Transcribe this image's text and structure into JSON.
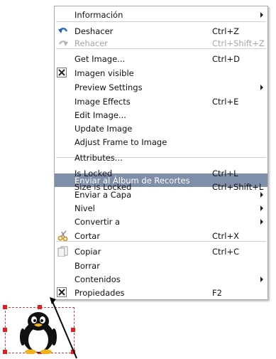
{
  "menu": {
    "items": [
      {
        "label": "Información",
        "shortcut": "",
        "submenu": true,
        "state": "normal"
      },
      {
        "label": "Deshacer",
        "shortcut": "Ctrl+Z",
        "submenu": false,
        "state": "normal",
        "icon": "undo-icon"
      },
      {
        "label": "Rehacer",
        "shortcut": "Ctrl+Shift+Z",
        "submenu": false,
        "state": "disabled",
        "icon": "redo-icon"
      },
      {
        "label": "Get Image...",
        "shortcut": "Ctrl+D",
        "submenu": false,
        "state": "normal"
      },
      {
        "label": "Imagen visible",
        "shortcut": "",
        "submenu": false,
        "state": "checked"
      },
      {
        "label": "Preview Settings",
        "shortcut": "",
        "submenu": true,
        "state": "normal"
      },
      {
        "label": "Image Effects",
        "shortcut": "Ctrl+E",
        "submenu": false,
        "state": "normal"
      },
      {
        "label": "Edit Image...",
        "shortcut": "",
        "submenu": false,
        "state": "normal"
      },
      {
        "label": "Update Image",
        "shortcut": "",
        "submenu": false,
        "state": "normal"
      },
      {
        "label": "Adjust Frame to Image",
        "shortcut": "",
        "submenu": false,
        "state": "normal"
      },
      {
        "label": "Attributes...",
        "shortcut": "",
        "submenu": false,
        "state": "normal"
      },
      {
        "label": "Is Locked",
        "shortcut": "Ctrl+L",
        "submenu": false,
        "state": "normal"
      },
      {
        "label": "Size is Locked",
        "shortcut": "Ctrl+Shift+L",
        "submenu": false,
        "state": "normal"
      },
      {
        "label": "Enviar al Álbum de Recortes",
        "shortcut": "",
        "submenu": false,
        "state": "selected"
      },
      {
        "label": "Enviar a Capa",
        "shortcut": "",
        "submenu": true,
        "state": "normal"
      },
      {
        "label": "Nivel",
        "shortcut": "",
        "submenu": true,
        "state": "normal"
      },
      {
        "label": "Convertir a",
        "shortcut": "",
        "submenu": true,
        "state": "normal"
      },
      {
        "label": "Cortar",
        "shortcut": "Ctrl+X",
        "submenu": false,
        "state": "normal",
        "icon": "cut-icon"
      },
      {
        "label": "Copiar",
        "shortcut": "Ctrl+C",
        "submenu": false,
        "state": "normal",
        "icon": "copy-icon"
      },
      {
        "label": "Borrar",
        "shortcut": "",
        "submenu": false,
        "state": "normal"
      },
      {
        "label": "Contenidos",
        "shortcut": "",
        "submenu": true,
        "state": "normal"
      },
      {
        "label": "Propiedades",
        "shortcut": "F2",
        "submenu": false,
        "state": "checked"
      }
    ]
  },
  "colors": {
    "selection": "#7f8ea9",
    "accent": "#2a6fc9",
    "frame": "#e02020"
  }
}
